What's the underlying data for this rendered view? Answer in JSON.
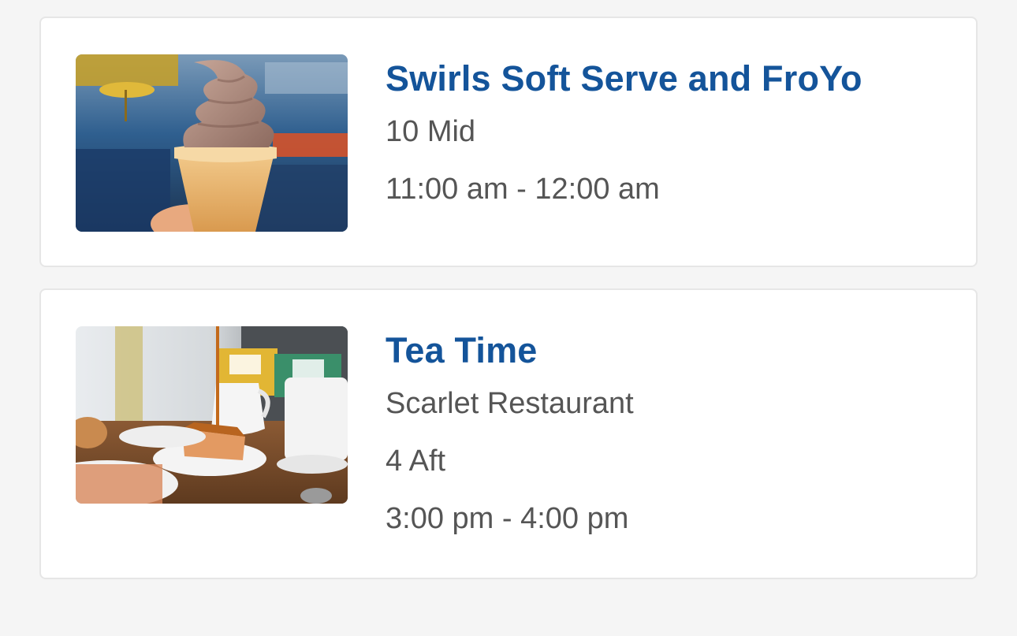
{
  "items": [
    {
      "title": "Swirls Soft Serve and FroYo",
      "location": "10 Mid",
      "hours": "11:00 am - 12:00 am",
      "image": "soft-serve-cone-photo"
    },
    {
      "title": "Tea Time",
      "venue": "Scarlet Restaurant",
      "location": "4 Aft",
      "hours": "3:00 pm - 4:00 pm",
      "image": "tea-time-table-photo"
    }
  ],
  "colors": {
    "title": "#14549a",
    "text": "#555555",
    "background": "#f5f5f5",
    "card": "#ffffff"
  }
}
